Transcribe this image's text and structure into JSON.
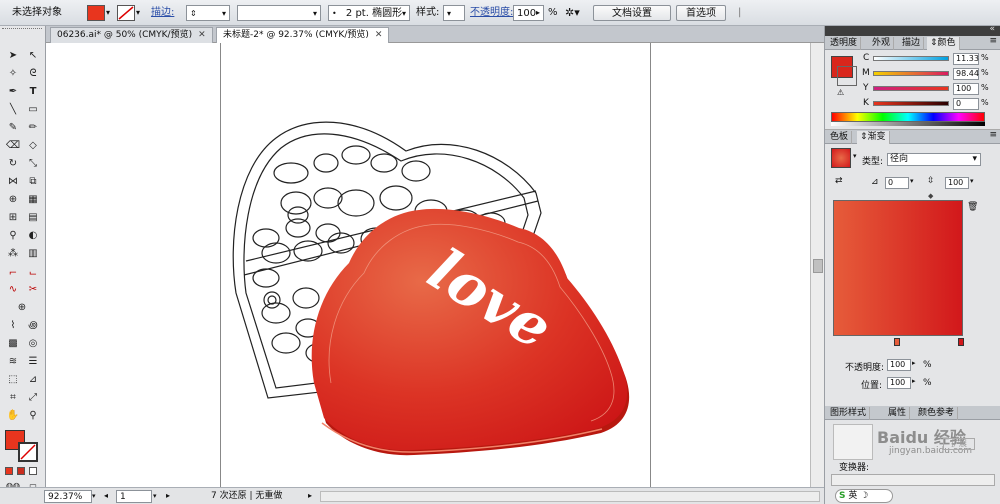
{
  "control_bar": {
    "selection_status": "未选择对象",
    "stroke_label": "描边:",
    "stroke_weight": "2 pt.",
    "brush_name": "椭圆形",
    "style_label": "样式:",
    "opacity_label": "不透明度:",
    "opacity_value": "100",
    "opacity_unit": "%",
    "doc_setup_button": "文档设置",
    "preferences_button": "首选项",
    "fill_color": "#e8351e"
  },
  "document_tabs": [
    {
      "label": "06236.ai* @ 50% (CMYK/预览)",
      "active": false
    },
    {
      "label": "未标题-2* @ 92.37% (CMYK/预览)",
      "active": true
    }
  ],
  "artwork": {
    "word": "love"
  },
  "status_bar": {
    "zoom": "92.37%",
    "page": "1",
    "undo_status": "7 次还原 | 无重做"
  },
  "color_panel": {
    "tabs": [
      "透明度",
      "外观",
      "描边",
      "颜色"
    ],
    "active_tab": "颜色",
    "channels": [
      {
        "label": "C",
        "value": "11.33",
        "color": "#00a0e0"
      },
      {
        "label": "M",
        "value": "98.44",
        "color": "#d81b60"
      },
      {
        "label": "Y",
        "value": "100",
        "color": "#f6e600"
      },
      {
        "label": "K",
        "value": "0",
        "color": "#222222"
      }
    ],
    "swatch": "#d9261c"
  },
  "gradient_panel": {
    "tabs": [
      "色板",
      "渐变"
    ],
    "active_tab": "渐变",
    "type_label": "类型:",
    "type_value": "径向",
    "angle_value": "0",
    "aspect_value": "100",
    "opacity_label": "不透明度:",
    "opacity_value": "100",
    "location_label": "位置:",
    "location_value": "100",
    "percent": "%",
    "start_color": "#e65c3a",
    "end_color": "#d2181b"
  },
  "bottom_panel": {
    "tabs": [
      "图形样式",
      "属性",
      "颜色参考"
    ],
    "watermark": "Baidu 经验",
    "watermark_url": "jingyan.baidu.com",
    "expand_label": "扩展",
    "shaper_label": "变换器:",
    "ime_label": "英"
  }
}
